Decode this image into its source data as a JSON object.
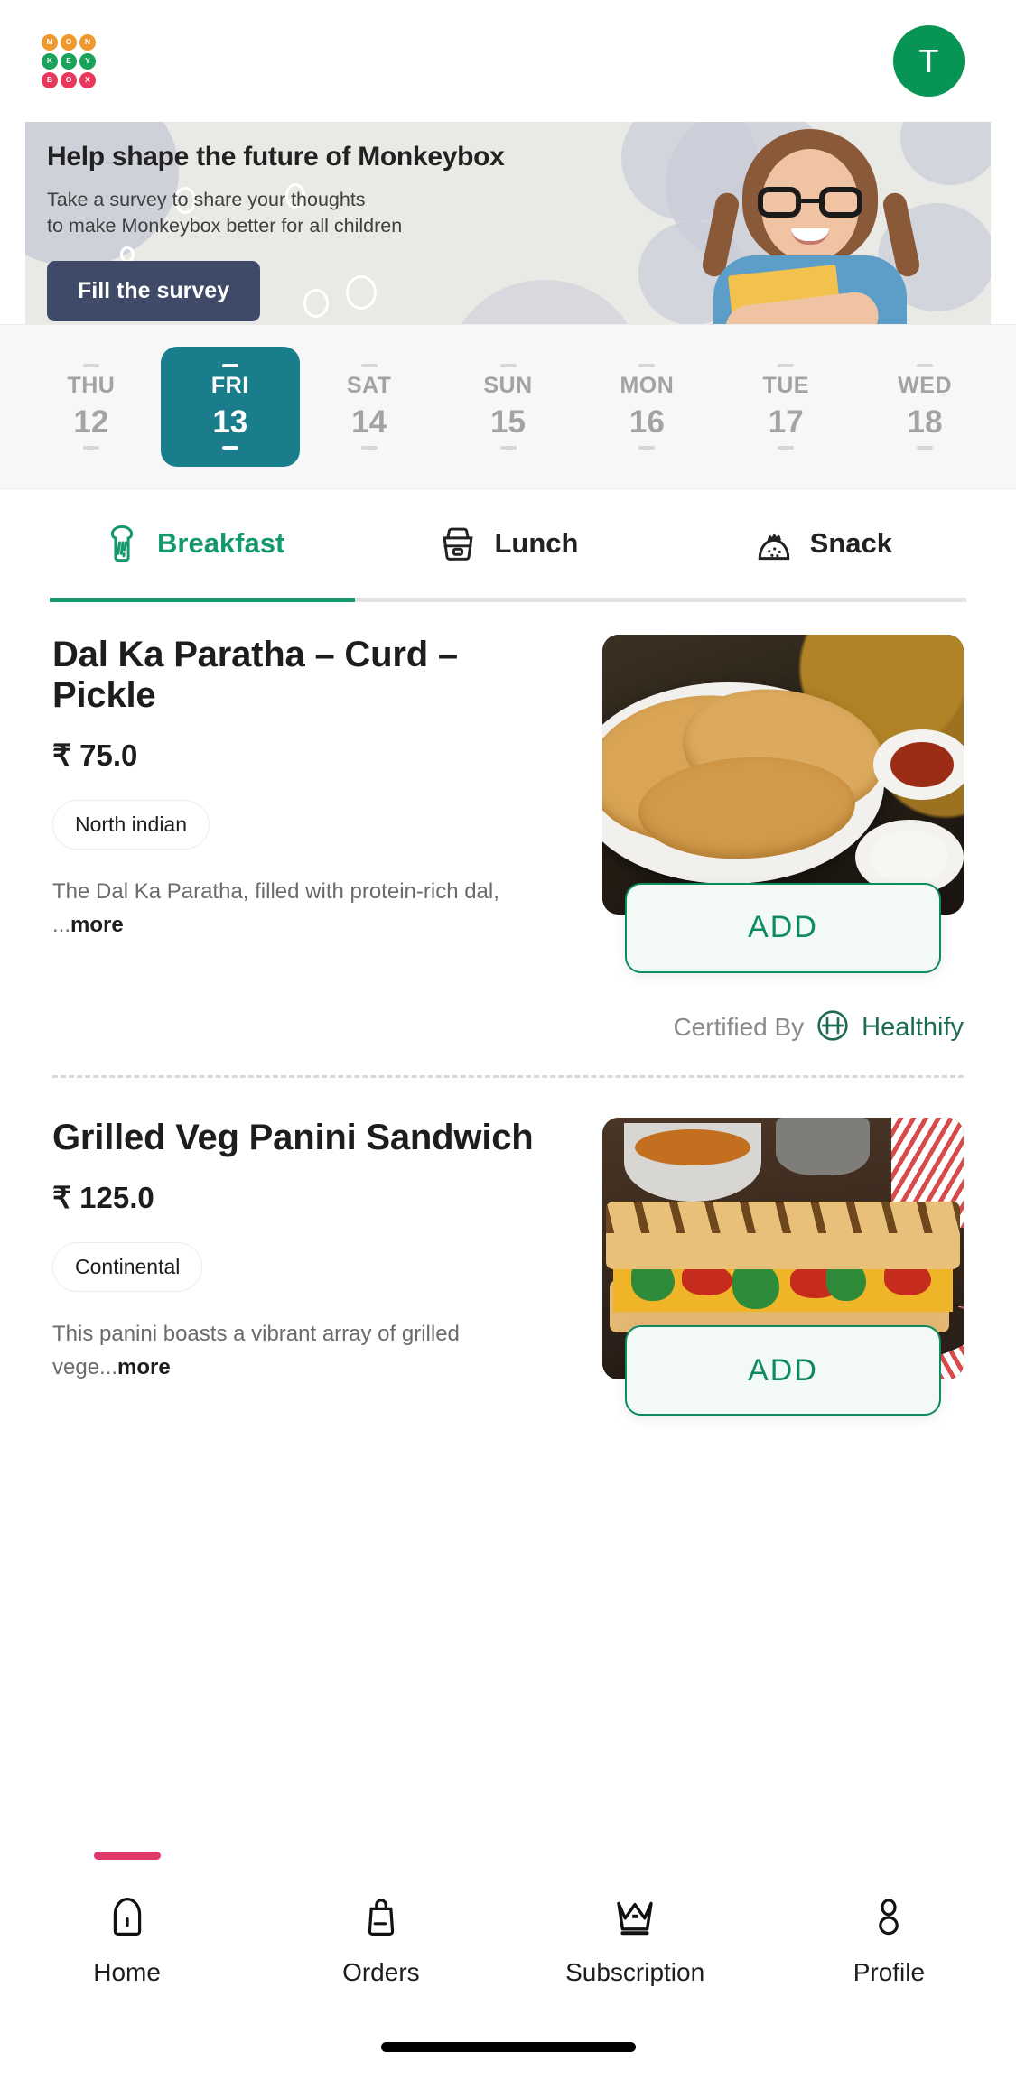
{
  "header": {
    "logo": {
      "name": "monkeybox-logo",
      "letters": [
        "M",
        "O",
        "N",
        "K",
        "E",
        "Y",
        "B",
        "O",
        "X"
      ],
      "colors": [
        "#F0982D",
        "#1AA35A",
        "#E8375A"
      ]
    },
    "avatar_initial": "T"
  },
  "banner": {
    "title": "Help shape the future of Monkeybox",
    "subtitle_line1": "Take a survey to share your thoughts",
    "subtitle_line2": "to make Monkeybox better for all children",
    "button_label": "Fill the survey",
    "button_color": "#3F4A68",
    "background_color": "#E9E9E5",
    "image_alt": "smiling-girl-with-glasses-holding-folder"
  },
  "date_strip": {
    "selected_index": 1,
    "selected_color": "#1A7D8C",
    "days": [
      {
        "dow": "THU",
        "date": "12"
      },
      {
        "dow": "FRI",
        "date": "13"
      },
      {
        "dow": "SAT",
        "date": "14"
      },
      {
        "dow": "SUN",
        "date": "15"
      },
      {
        "dow": "MON",
        "date": "16"
      },
      {
        "dow": "TUE",
        "date": "17"
      },
      {
        "dow": "WED",
        "date": "18"
      }
    ]
  },
  "meal_tabs": {
    "active_index": 0,
    "active_color": "#14996B",
    "tabs": [
      {
        "label": "Breakfast",
        "icon": "bread-slice-icon"
      },
      {
        "label": "Lunch",
        "icon": "lunchbox-icon"
      },
      {
        "label": "Snack",
        "icon": "snack-bag-icon"
      }
    ]
  },
  "items": [
    {
      "name": "Dal Ka Paratha – Curd – Pickle",
      "price": "₹ 75.0",
      "cuisine": "North indian",
      "description": "The Dal Ka Paratha, filled with protein-rich dal, ...",
      "description_more": "more",
      "add_label": "ADD",
      "image_alt": "dal-ka-paratha-plate-with-curd-and-pickle",
      "certified": {
        "prefix": "Certified By",
        "brand": "Healthify",
        "logo": "healthify-h-icon"
      }
    },
    {
      "name": "Grilled Veg Panini Sandwich",
      "price": "₹ 125.0",
      "cuisine": "Continental",
      "description": "This panini boasts a vibrant array of grilled vege...",
      "description_more": "more",
      "add_label": "ADD",
      "image_alt": "grilled-veg-panini-sandwich-on-dark-plate"
    }
  ],
  "bottom_nav": {
    "active_index": 0,
    "indicator_color": "#E03A6D",
    "items": [
      {
        "label": "Home",
        "icon": "home-icon"
      },
      {
        "label": "Orders",
        "icon": "bag-icon"
      },
      {
        "label": "Subscription",
        "icon": "crown-icon"
      },
      {
        "label": "Profile",
        "icon": "person-icon"
      }
    ]
  }
}
